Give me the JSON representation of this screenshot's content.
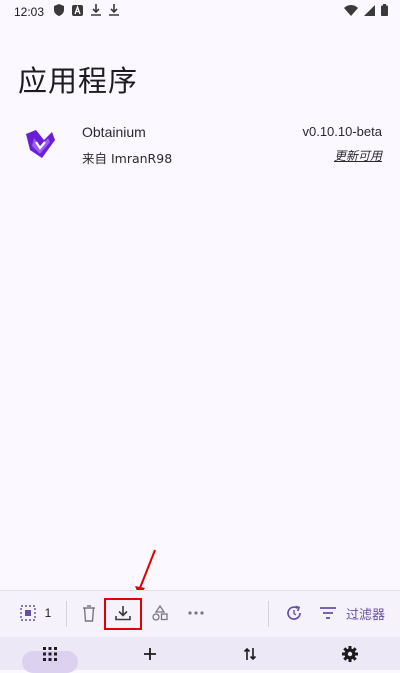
{
  "status_bar": {
    "time": "12:03",
    "icons": [
      "shield-icon",
      "a-badge-icon",
      "download-icon",
      "download-icon",
      "wifi-icon",
      "signal-icon",
      "battery-icon"
    ]
  },
  "page": {
    "title": "应用程序"
  },
  "apps": [
    {
      "name": "Obtainium",
      "source": "来自 ImranR98",
      "version": "v0.10.10-beta",
      "status": "更新可用",
      "icon": "obtainium-logo-icon"
    }
  ],
  "toolbar": {
    "selected_count": "1",
    "filter_label": "过滤器",
    "buttons": [
      "select-all-icon",
      "trash-icon",
      "download-icon",
      "shapes-icon",
      "more-icon",
      "refresh-icon",
      "filter-icon"
    ]
  },
  "colors": {
    "background": "#fcf8ff",
    "accent": "#6750a4",
    "logo": "#6a1fd6",
    "annotation": "#e00000"
  },
  "nav": {
    "items": [
      "apps-grid-icon",
      "add-icon",
      "sort-icon",
      "settings-icon"
    ]
  }
}
